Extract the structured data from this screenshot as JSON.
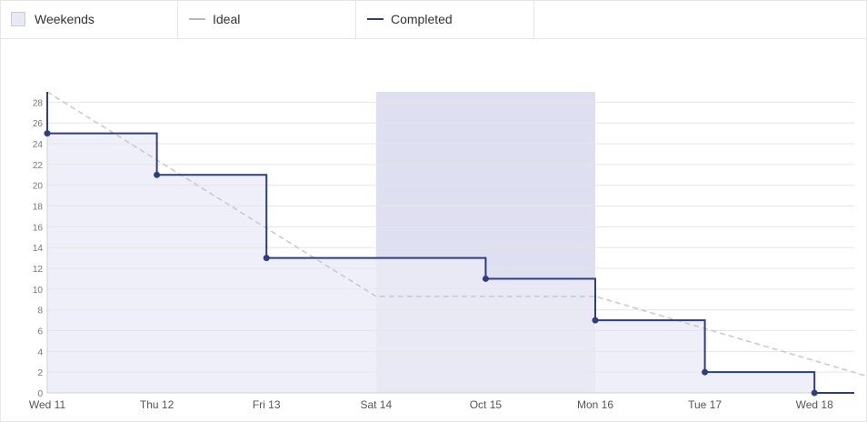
{
  "legend": {
    "weekends": "Weekends",
    "ideal": "Ideal",
    "completed": "Completed"
  },
  "colors": {
    "weekend_band": "#dedff0",
    "completed_area": "#ebebf7",
    "completed_line": "#2f3f7e",
    "ideal_line": "#c8c8c8",
    "grid": "#e6e6e6"
  },
  "chart_data": {
    "type": "line",
    "x": [
      "Wed 11",
      "Thu 12",
      "Fri 13",
      "Sat 14",
      "Oct 15",
      "Mon 16",
      "Tue 17",
      "Wed 18"
    ],
    "ylim": [
      0,
      29
    ],
    "yticks": [
      0,
      2,
      4,
      6,
      8,
      10,
      12,
      14,
      16,
      18,
      20,
      22,
      24,
      26,
      28
    ],
    "weekend_range": [
      "Sat 14",
      "Mon 16"
    ],
    "series": [
      {
        "name": "Completed",
        "step": true,
        "x": [
          "Wed 11",
          "Thu 12",
          "Fri 13",
          "Oct 15",
          "Mon 16",
          "Tue 17",
          "Wed 18"
        ],
        "values": [
          25,
          21,
          13,
          11,
          7,
          2,
          0
        ]
      },
      {
        "name": "Ideal",
        "dashed": true,
        "x": [
          "Wed 11",
          "Sat 14",
          "Mon 16",
          "Thu 19"
        ],
        "values": [
          29,
          9.3,
          9.3,
          0
        ]
      }
    ],
    "grid": true
  }
}
